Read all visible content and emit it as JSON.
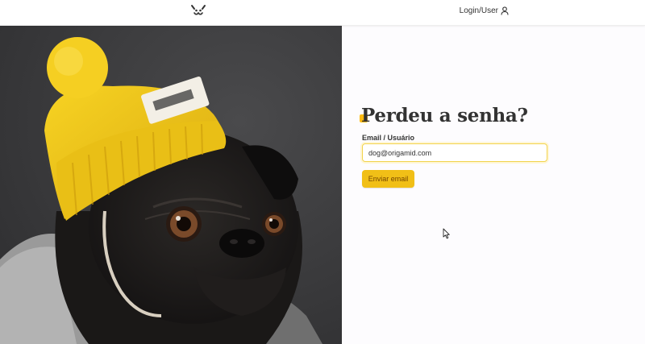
{
  "header": {
    "logo_icon": "dog-face-icon",
    "login_label": "Login/User",
    "login_icon": "user-icon"
  },
  "photo": {
    "subject": "pug-with-yellow-beanie"
  },
  "form": {
    "title": "Perdeu a senha?",
    "email_label": "Email / Usuário",
    "email_value": "dog@origamid.com",
    "submit_label": "Enviar email"
  },
  "colors": {
    "accent": "#ffbb11",
    "button_bg": "#f1bf17",
    "button_text": "#764701",
    "input_border": "#f2d34c",
    "hat_yellow": "#f2c418"
  }
}
